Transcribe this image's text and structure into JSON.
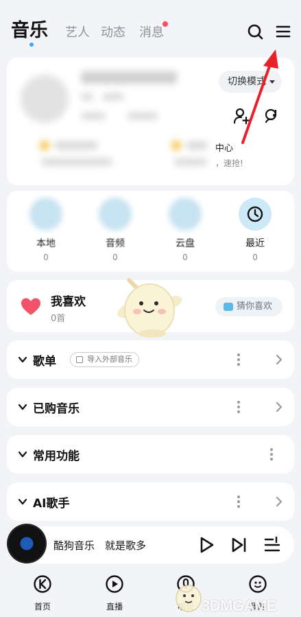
{
  "top_tabs": {
    "main": "音乐",
    "artists": "艺人",
    "feed": "动态",
    "messages": "消息"
  },
  "icons": {
    "search": "search-icon",
    "menu": "menu-icon"
  },
  "profile": {
    "switch_mode": "切换模式",
    "center_label": "中心",
    "grab_label": "，速抢!"
  },
  "quick_entries": [
    {
      "label": "本地",
      "count": "0"
    },
    {
      "label": "音频",
      "count": "0"
    },
    {
      "label": "云盘",
      "count": "0"
    },
    {
      "label": "最近",
      "count": "0"
    }
  ],
  "favorites": {
    "title": "我喜欢",
    "count": "0首",
    "guess_button": "猜你喜欢"
  },
  "sections": [
    {
      "title": "歌单",
      "tag": "导入外部音乐"
    },
    {
      "title": "已购音乐"
    },
    {
      "title": "常用功能"
    },
    {
      "title": "AI歌手"
    }
  ],
  "player": {
    "title": "酷狗音乐　就是歌多"
  },
  "bottom_nav": [
    {
      "label": "首页"
    },
    {
      "label": "直播"
    },
    {
      "label": "唱玩"
    },
    {
      "label": "我的"
    }
  ],
  "watermark": "3DMGAME",
  "colors": {
    "accent_blue": "#3aa8f0",
    "badge_red": "#ff4d5f",
    "heart_red": "#f2536a",
    "annotation_red": "#e8202a"
  }
}
